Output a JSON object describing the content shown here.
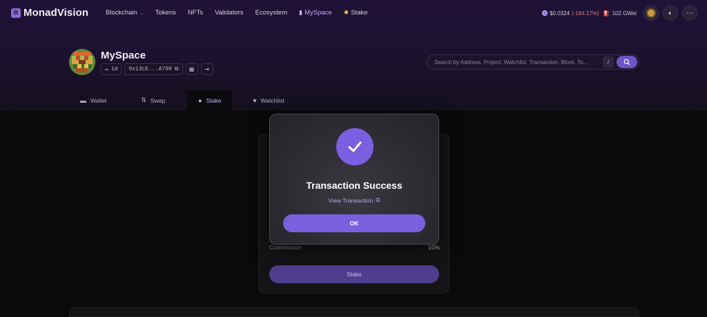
{
  "app": {
    "title": "MonadVision"
  },
  "nav": {
    "items": [
      {
        "label": "Blockchain",
        "has_dropdown": true
      },
      {
        "label": "Tokens"
      },
      {
        "label": "NFTs"
      },
      {
        "label": "Validators"
      },
      {
        "label": "Ecosystem"
      },
      {
        "label": "MySpace",
        "active": true
      },
      {
        "label": "Stake"
      }
    ],
    "price": "$0.0324",
    "price_change": "(-184.17%)",
    "gas": "102 GWei"
  },
  "profile": {
    "title": "MySpace",
    "age": "1d",
    "address": "0x13cE...A799"
  },
  "search": {
    "placeholder": "Search by Address, Project, Watchlist, Transaction, Block, To...",
    "shortcut": "/"
  },
  "tabs": [
    {
      "label": "Wallet"
    },
    {
      "label": "Swap"
    },
    {
      "label": "Stake",
      "active": true
    },
    {
      "label": "Watchlist"
    }
  ],
  "stake_card": {
    "commission_label": "Commission",
    "commission_value": "10%",
    "button_label": "Stake"
  },
  "modal": {
    "title": "Transaction Success",
    "link_label": "View Transaction",
    "ok_label": "OK"
  },
  "colors": {
    "accent": "#7a60dd",
    "negative": "#e0797a",
    "header_bg": "#1f1237"
  }
}
